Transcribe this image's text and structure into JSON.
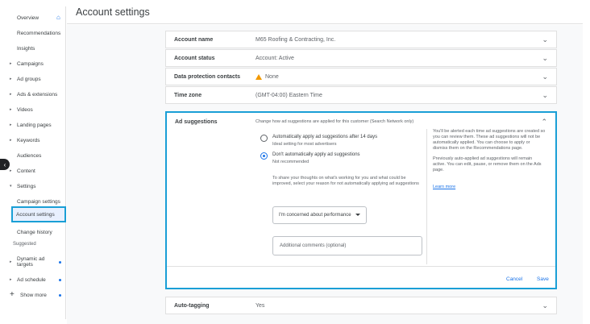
{
  "sidebar": {
    "overview": "Overview",
    "items": [
      {
        "label": "Recommendations"
      },
      {
        "label": "Insights"
      },
      {
        "label": "Campaigns"
      },
      {
        "label": "Ad groups"
      },
      {
        "label": "Ads & extensions"
      },
      {
        "label": "Videos"
      },
      {
        "label": "Landing pages"
      },
      {
        "label": "Keywords"
      },
      {
        "label": "Audiences"
      },
      {
        "label": "Content"
      },
      {
        "label": "Settings"
      },
      {
        "label": "Campaign settings"
      },
      {
        "label": "Account settings"
      },
      {
        "label": "Change history"
      }
    ],
    "suggested_heading": "Suggested",
    "suggested": [
      {
        "label": "Dynamic ad targets"
      },
      {
        "label": "Ad schedule"
      }
    ],
    "show_more": "Show more"
  },
  "header": {
    "title": "Account settings"
  },
  "settings": [
    {
      "label": "Account name",
      "value": "M65 Roofing & Contracting, Inc."
    },
    {
      "label": "Account status",
      "value": "Account: Active"
    },
    {
      "label": "Data protection contacts",
      "value": "None"
    },
    {
      "label": "Time zone",
      "value": "(GMT-04:00) Eastern Time"
    }
  ],
  "ad_suggestions": {
    "label": "Ad suggestions",
    "description": "Change how ad suggestions are applied for this customer (Search Network only)",
    "option1": {
      "label": "Automatically apply ad suggestions after 14 days",
      "sub": "Ideal setting for most advertisers"
    },
    "option2": {
      "label": "Don't automatically apply ad suggestions",
      "sub": "Not recommended"
    },
    "feedback": "To share your thoughts on what's working for you and what could be improved, select your reason for not automatically applying ad suggestions",
    "reason_selected": "I'm concerned about performance",
    "comments_placeholder": "Additional comments (optional)",
    "info1": "You'll be alerted each time ad suggestions are created so you can review them. These ad suggestions will not be automatically applied. You can choose to apply or dismiss them on the Recommendations page.",
    "info2": "Previously auto-applied ad suggestions will remain active. You can edit, pause, or remove them on the Ads page.",
    "learn_more": "Learn more",
    "cancel": "Cancel",
    "save": "Save"
  },
  "auto_tagging": {
    "label": "Auto-tagging",
    "value": "Yes"
  },
  "colors": {
    "accent": "#1a73e8",
    "highlight": "#1a9fd6",
    "warning": "#f29900"
  }
}
